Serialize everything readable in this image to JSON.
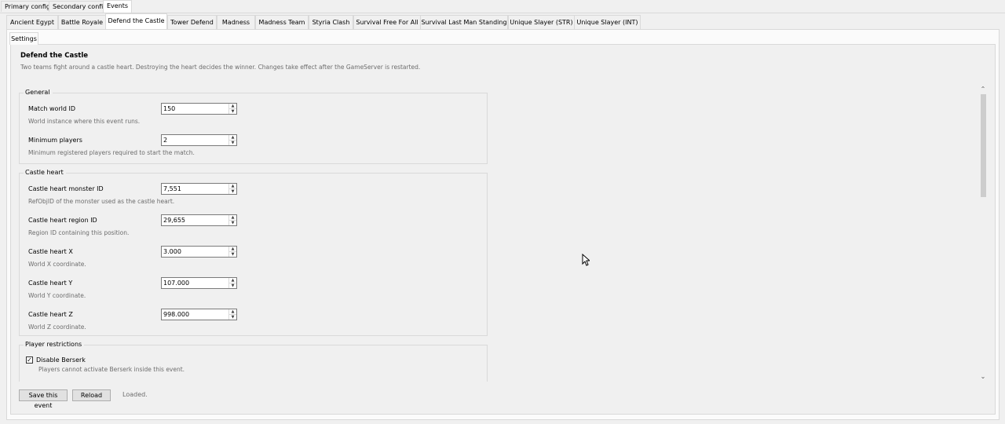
{
  "top_tabs": [
    {
      "label": "Primary config"
    },
    {
      "label": "Secondary config"
    },
    {
      "label": "Events"
    }
  ],
  "event_tabs": [
    {
      "label": "Ancient Egypt"
    },
    {
      "label": "Battle Royale"
    },
    {
      "label": "Defend the Castle"
    },
    {
      "label": "Tower Defend"
    },
    {
      "label": "Madness"
    },
    {
      "label": "Madness Team"
    },
    {
      "label": "Styria Clash"
    },
    {
      "label": "Survival Free For All"
    },
    {
      "label": "Survival Last Man Standing"
    },
    {
      "label": "Unique Slayer (STR)"
    },
    {
      "label": "Unique Slayer (INT)"
    }
  ],
  "active_event_tab": "Defend the Castle",
  "sub_tab": {
    "label": "Settings"
  },
  "event": {
    "title": "Defend the Castle",
    "description": "Two teams fight around a castle heart. Destroying the heart decides the winner. Changes take effect after the GameServer is restarted."
  },
  "groups": {
    "general": {
      "title": "General",
      "fields": [
        {
          "label": "Match world ID",
          "value": "150",
          "help": "World instance where this event runs."
        },
        {
          "label": "Minimum players",
          "value": "2",
          "help": "Minimum registered players required to start the match."
        }
      ]
    },
    "castle_heart": {
      "title": "Castle heart",
      "fields": [
        {
          "label": "Castle heart monster ID",
          "value": "7,551",
          "help": "RefObjID of the monster used as the castle heart."
        },
        {
          "label": "Castle heart region ID",
          "value": "29,655",
          "help": "Region ID containing this position."
        },
        {
          "label": "Castle heart X",
          "value": "3.000",
          "help": "World X coordinate."
        },
        {
          "label": "Castle heart Y",
          "value": "107.000",
          "help": "World Y coordinate."
        },
        {
          "label": "Castle heart Z",
          "value": "998.000",
          "help": "World Z coordinate."
        }
      ]
    },
    "player_restrictions": {
      "title": "Player restrictions",
      "checkboxes": [
        {
          "label": "Disable Berserk",
          "checked": true,
          "help": "Players cannot activate Berserk inside this event."
        }
      ]
    }
  },
  "buttons": {
    "save": "Save this event",
    "reload": "Reload"
  },
  "status": "Loaded.",
  "icons": {
    "spin_up": "spin-up-arrow",
    "spin_down": "spin-down-arrow",
    "scroll_up": "chevron-up",
    "scroll_down": "chevron-down",
    "checkmark": "checkmark",
    "cursor": "mouse-pointer"
  },
  "colors": {
    "window_bg": "#f0f0f0",
    "border": "#d9d9d9",
    "help_text": "#6d6d6d",
    "button_bg": "#e1e1e1",
    "scroll_thumb": "#cdcdcd"
  }
}
